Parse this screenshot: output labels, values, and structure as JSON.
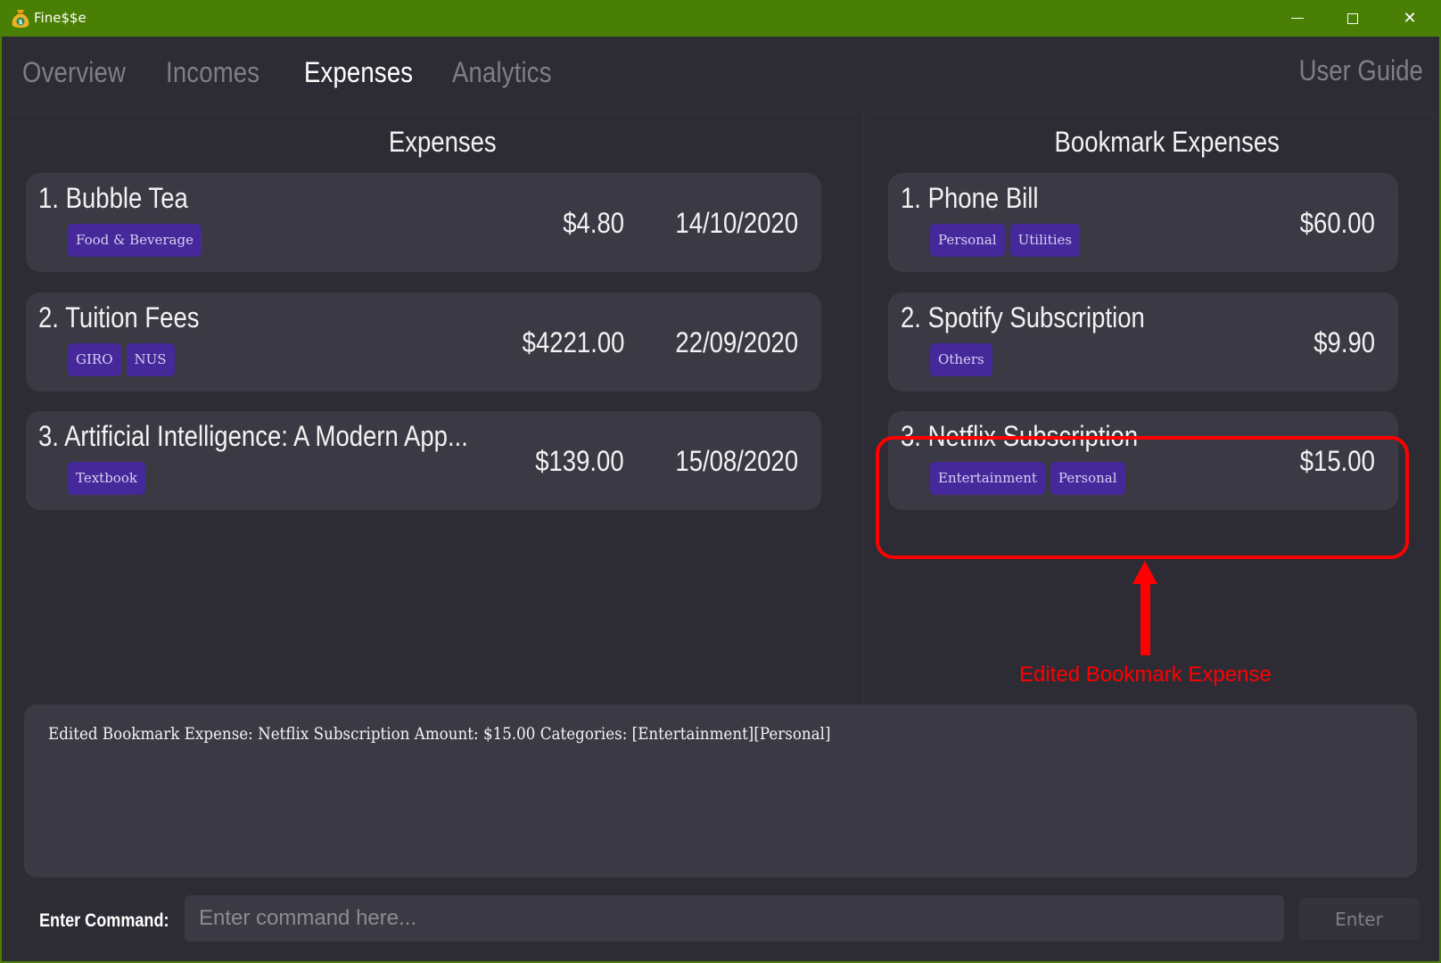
{
  "window": {
    "title": "Fine$$e",
    "controls": {
      "minimize": "minimize",
      "maximize": "maximize",
      "close": "✕"
    }
  },
  "nav": {
    "tabs": [
      {
        "label": "Overview",
        "active": false
      },
      {
        "label": "Incomes",
        "active": false
      },
      {
        "label": "Expenses",
        "active": true
      },
      {
        "label": "Analytics",
        "active": false
      }
    ],
    "user_guide": "User Guide"
  },
  "expenses": {
    "title": "Expenses",
    "items": [
      {
        "index": "1.",
        "title": "Bubble Tea",
        "amount": "$4.80",
        "date": "14/10/2020",
        "tags": [
          "Food & Beverage"
        ]
      },
      {
        "index": "2.",
        "title": "Tuition Fees",
        "amount": "$4221.00",
        "date": "22/09/2020",
        "tags": [
          "GIRO",
          "NUS"
        ]
      },
      {
        "index": "3.",
        "title": "Artificial Intelligence: A Modern App...",
        "amount": "$139.00",
        "date": "15/08/2020",
        "tags": [
          "Textbook"
        ]
      }
    ]
  },
  "bookmarks": {
    "title": "Bookmark Expenses",
    "items": [
      {
        "index": "1.",
        "title": "Phone Bill",
        "amount": "$60.00",
        "tags": [
          "Personal",
          "Utilities"
        ]
      },
      {
        "index": "2.",
        "title": "Spotify Subscription",
        "amount": "$9.90",
        "tags": [
          "Others"
        ]
      },
      {
        "index": "3.",
        "title": "Netflix Subscription",
        "amount": "$15.00",
        "tags": [
          "Entertainment",
          "Personal"
        ]
      }
    ]
  },
  "annotation": {
    "label": "Edited Bookmark Expense",
    "color": "#ff0000"
  },
  "result": {
    "text": "Edited Bookmark Expense: Netflix Subscription Amount: $15.00 Categories: [Entertainment][Personal]"
  },
  "command": {
    "label": "Enter Command:",
    "placeholder": "Enter command here...",
    "value": "",
    "button": "Enter"
  },
  "colors": {
    "titlebar": "#4a7f05",
    "background": "#2d2c35",
    "card": "#3b3a44",
    "tag": "#45289a",
    "tab_active": "#ffffff",
    "tab_inactive": "#7e7e84"
  }
}
